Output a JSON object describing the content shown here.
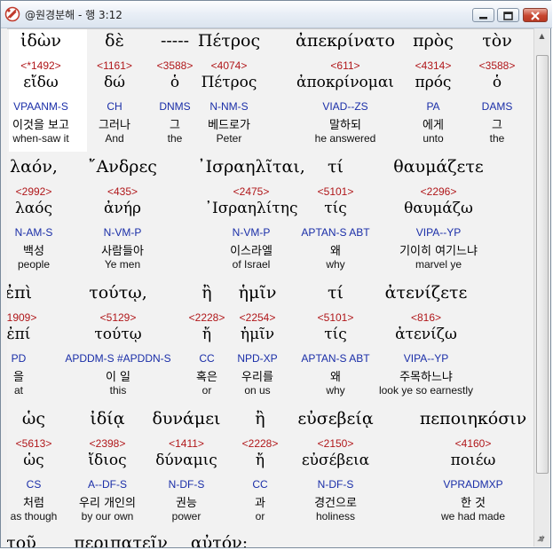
{
  "window": {
    "title": "@원경분해 - 행 3:12"
  },
  "rows": [
    {
      "words": [
        {
          "greek": "ἰδὼν",
          "strong": "<*1492>",
          "lemma": "εἴδω",
          "parse": "VPAANM-S",
          "korean": "이것을 보고",
          "english": "when-saw it"
        },
        {
          "greek": "δὲ",
          "strong": "<1161>",
          "lemma": "δώ",
          "parse": "CH",
          "korean": "그러나",
          "english": "And"
        },
        {
          "greek": "-----",
          "strong": "<3588>",
          "lemma": "ὁ",
          "parse": "DNMS",
          "korean": "그",
          "english": "the"
        },
        {
          "greek": "Πέτρος",
          "strong": "<4074>",
          "lemma": "Πέτρος",
          "parse": "N-NM-S",
          "korean": "베드로가",
          "english": "Peter"
        },
        {
          "greek": "ἀπεκρίνατο",
          "strong": "<611>",
          "lemma": "ἀποκρίνομαι",
          "parse": "VIAD--ZS",
          "korean": "말하되",
          "english": "he answered"
        },
        {
          "greek": "πρὸς",
          "strong": "<4314>",
          "lemma": "πρός",
          "parse": "PA",
          "korean": "에게",
          "english": "unto"
        },
        {
          "greek": "τὸν",
          "strong": "<3588>",
          "lemma": "ὁ",
          "parse": "DAMS",
          "korean": "그",
          "english": "the"
        }
      ]
    },
    {
      "words": [
        {
          "greek": "λαόν,",
          "strong": "<2992>",
          "lemma": "λαός",
          "parse": "N-AM-S",
          "korean": "백성",
          "english": "people"
        },
        {
          "greek": "῎Ανδρες",
          "strong": "<435>",
          "lemma": "ἀνήρ",
          "parse": "N-VM-P",
          "korean": "사람들아",
          "english": "Ye men"
        },
        {
          "greek": "᾿Ισραηλῖται,",
          "strong": "<2475>",
          "lemma": "᾿Ισραηλίτης",
          "parse": "N-VM-P",
          "korean": "이스라엘",
          "english": "of Israel"
        },
        {
          "greek": "τί",
          "strong": "<5101>",
          "lemma": "τίς",
          "parse": "APTAN-S ABT",
          "korean": "왜",
          "english": "why"
        },
        {
          "greek": "θαυμάζετε",
          "strong": "<2296>",
          "lemma": "θαυμάζω",
          "parse": "VIPA--YP",
          "korean": "기이히 여기느냐",
          "english": "marvel ye"
        }
      ]
    },
    {
      "words": [
        {
          "greek": "ἐπὶ",
          "strong": "<1909>",
          "lemma": "ἐπί",
          "parse": "PD",
          "korean": "을",
          "english": "at"
        },
        {
          "greek": "τούτῳ,",
          "strong": "<5129>",
          "lemma": "τούτῳ",
          "parse": "APDDM-S #APDDN-S",
          "korean": "이 일",
          "english": "this"
        },
        {
          "greek": "ἢ",
          "strong": "<2228>",
          "lemma": "ἤ",
          "parse": "CC",
          "korean": "혹은",
          "english": "or"
        },
        {
          "greek": "ἡμῖν",
          "strong": "<2254>",
          "lemma": "ἡμῖν",
          "parse": "NPD-XP",
          "korean": "우리를",
          "english": "on us"
        },
        {
          "greek": "τί",
          "strong": "<5101>",
          "lemma": "τίς",
          "parse": "APTAN-S ABT",
          "korean": "왜",
          "english": "why"
        },
        {
          "greek": "ἀτενίζετε",
          "strong": "<816>",
          "lemma": "ἀτενίζω",
          "parse": "VIPA--YP",
          "korean": "주목하느냐",
          "english": "look ye so earnestly"
        }
      ]
    },
    {
      "words": [
        {
          "greek": "ὡς",
          "strong": "<5613>",
          "lemma": "ὡς",
          "parse": "CS",
          "korean": "처럼",
          "english": "as though"
        },
        {
          "greek": "ἰδίᾳ",
          "strong": "<2398>",
          "lemma": "ἴδιος",
          "parse": "A--DF-S",
          "korean": "우리 개인의",
          "english": "by our own"
        },
        {
          "greek": "δυνάμει",
          "strong": "<1411>",
          "lemma": "δύναμις",
          "parse": "N-DF-S",
          "korean": "권능",
          "english": "power"
        },
        {
          "greek": "ἢ",
          "strong": "<2228>",
          "lemma": "ἤ",
          "parse": "CC",
          "korean": "과",
          "english": "or"
        },
        {
          "greek": "εὐσεβείᾳ",
          "strong": "<2150>",
          "lemma": "εὐσέβεια",
          "parse": "N-DF-S",
          "korean": "경건으로",
          "english": "holiness"
        },
        {
          "greek": "πεποιηκόσιν",
          "strong": "<4160>",
          "lemma": "ποιέω",
          "parse": "VPRADMXP",
          "korean": "한 것",
          "english": "we had made"
        }
      ]
    },
    {
      "words": [
        {
          "greek": "τοῦ"
        },
        {
          "greek": "περιπατεῖν"
        },
        {
          "greek": "αὐτόν;"
        }
      ]
    }
  ]
}
